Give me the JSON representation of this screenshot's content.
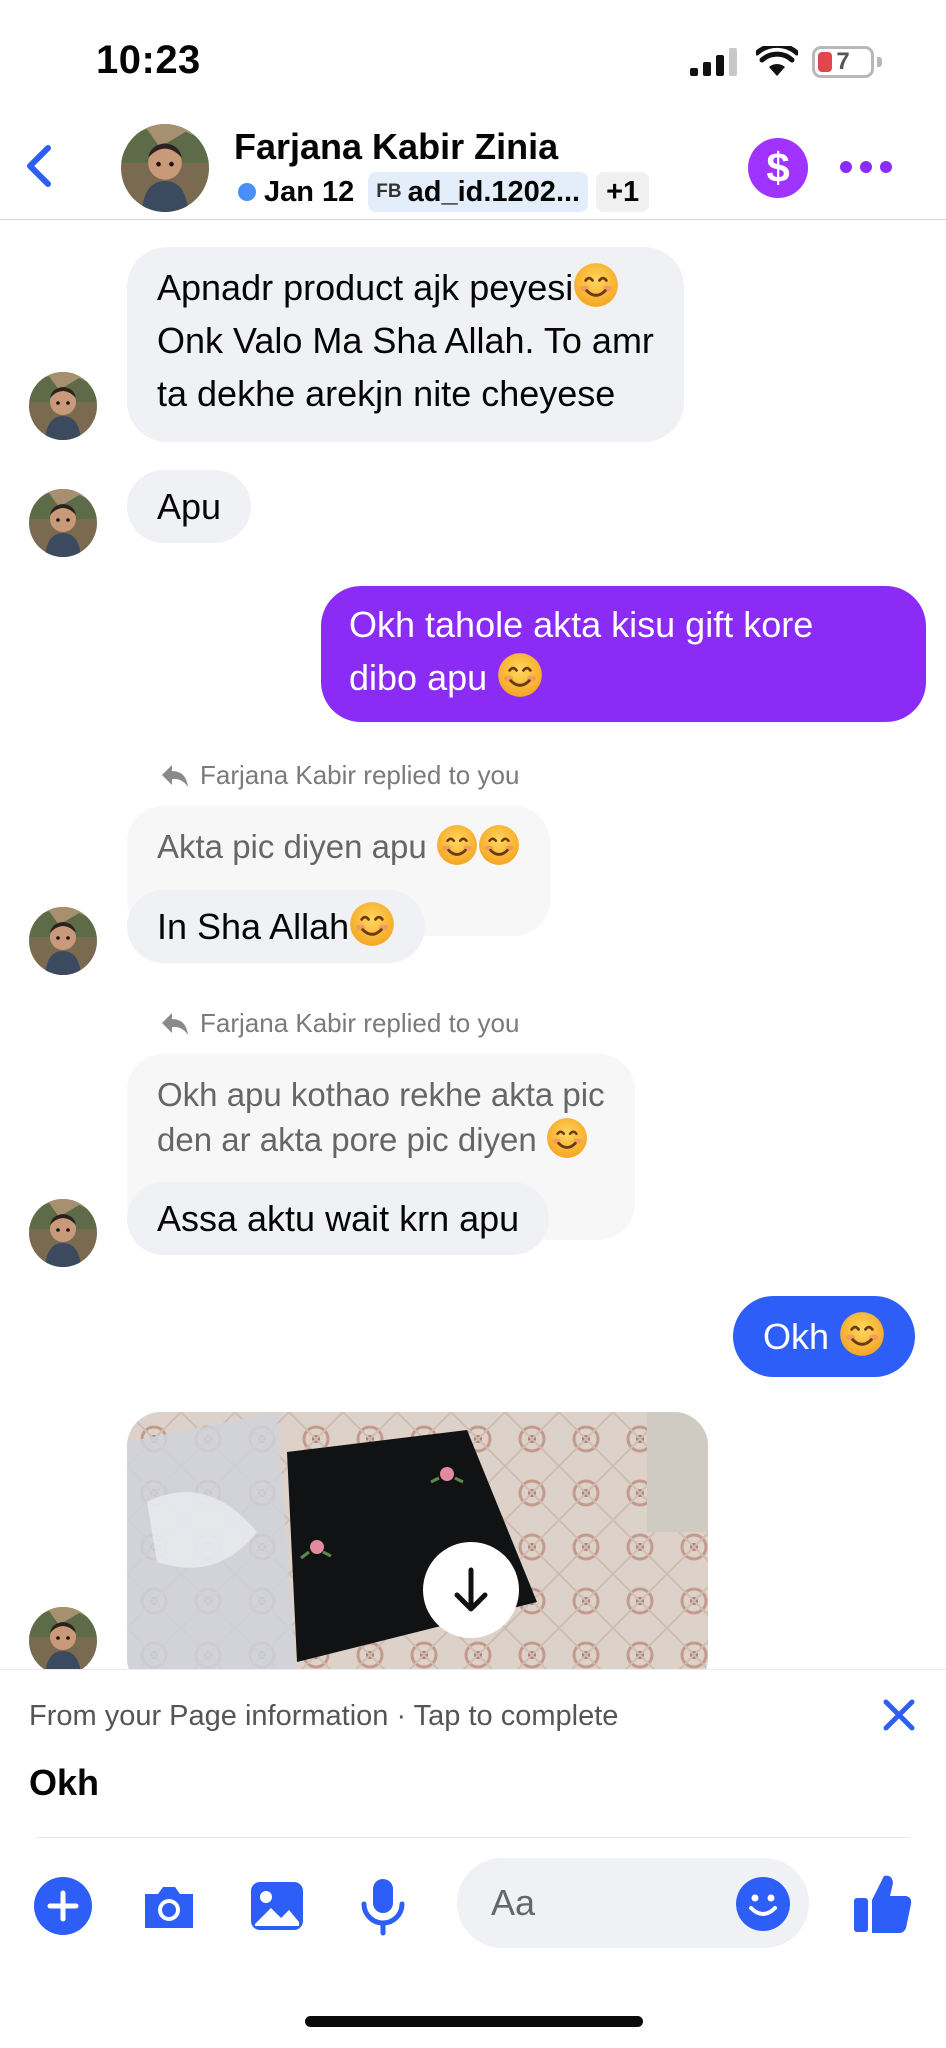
{
  "status_bar": {
    "time": "10:23",
    "battery": "7"
  },
  "header": {
    "name": "Farjana Kabir Zinia",
    "date": "Jan 12",
    "chip_prefix": "FB",
    "chip_text": "ad_id.1202...",
    "extra_count": "+1",
    "pay_symbol": "$"
  },
  "messages": {
    "m1": {
      "line1": "Apnadr product ajk peyesi",
      "line2": "Onk Valo Ma Sha Allah. To amr",
      "line3": "ta dekhe arekjn nite cheyese"
    },
    "m2": {
      "text": "Apu"
    },
    "m3": {
      "line1": "Okh tahole akta kisu gift kore",
      "line2": "dibo apu "
    },
    "reply1": {
      "label": "Farjana Kabir replied to you",
      "quoted": "Akta pic diyen apu ",
      "text": "In Sha Allah"
    },
    "reply2": {
      "label": "Farjana Kabir replied to you",
      "quoted_line1": "Okh apu kothao rekhe akta pic",
      "quoted_line2": "den ar akta pore pic diyen ",
      "text": "Assa aktu wait krn apu"
    },
    "m4": {
      "text": "Okh "
    }
  },
  "suggestion": {
    "hint": "From your Page information · Tap to complete",
    "text": "Okh"
  },
  "composer": {
    "placeholder": "Aa"
  },
  "colors": {
    "accent_blue": "#2d5ef8",
    "outgoing_purple": "#8a2cf5",
    "incoming_gray": "#f0f1f5",
    "pay_purple": "#a033ff"
  },
  "icons": [
    "back-chevron-icon",
    "dollar-icon",
    "more-dots-icon",
    "reply-arrow-icon",
    "download-icon",
    "close-icon",
    "plus-icon",
    "camera-icon",
    "gallery-icon",
    "microphone-icon",
    "smiley-icon",
    "thumbs-up-icon",
    "smile-emoji"
  ]
}
